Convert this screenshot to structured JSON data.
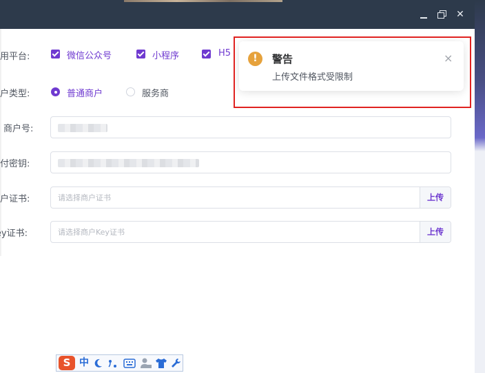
{
  "window": {
    "minimize_icon": "minimize-icon",
    "maximize_icon": "restore-icon",
    "close_glyph": "✕"
  },
  "form": {
    "platform": {
      "label": "应用平台:",
      "options": [
        "微信公众号",
        "小程序",
        "H5"
      ]
    },
    "merchant_type": {
      "label": "商户类型:",
      "options": [
        "普通商户",
        "服务商"
      ],
      "selected": "普通商户"
    },
    "merchant_no": {
      "label": "商户号:"
    },
    "pay_secret": {
      "label": "支付密钥:"
    },
    "merchant_cert": {
      "label": "商户证书:",
      "placeholder": "请选择商户证书",
      "button": "上传"
    },
    "key_cert": {
      "label": "Key证书:",
      "placeholder": "请选择商户Key证书",
      "button": "上传"
    }
  },
  "notification": {
    "icon": "warning-icon",
    "icon_glyph": "!",
    "title": "警告",
    "message": "上传文件格式受限制",
    "close_glyph": "×"
  },
  "ime": {
    "logo": "S",
    "mode": "中",
    "icons": [
      "moon-icon",
      "punctuation-icon",
      "keyboard-icon",
      "user-icon",
      "shirt-icon",
      "wrench-icon"
    ]
  },
  "colors": {
    "accent": "#6f3ad0",
    "warning": "#e6a23c",
    "titlebar": "#2d3a4b",
    "highlight": "#e0211f"
  }
}
